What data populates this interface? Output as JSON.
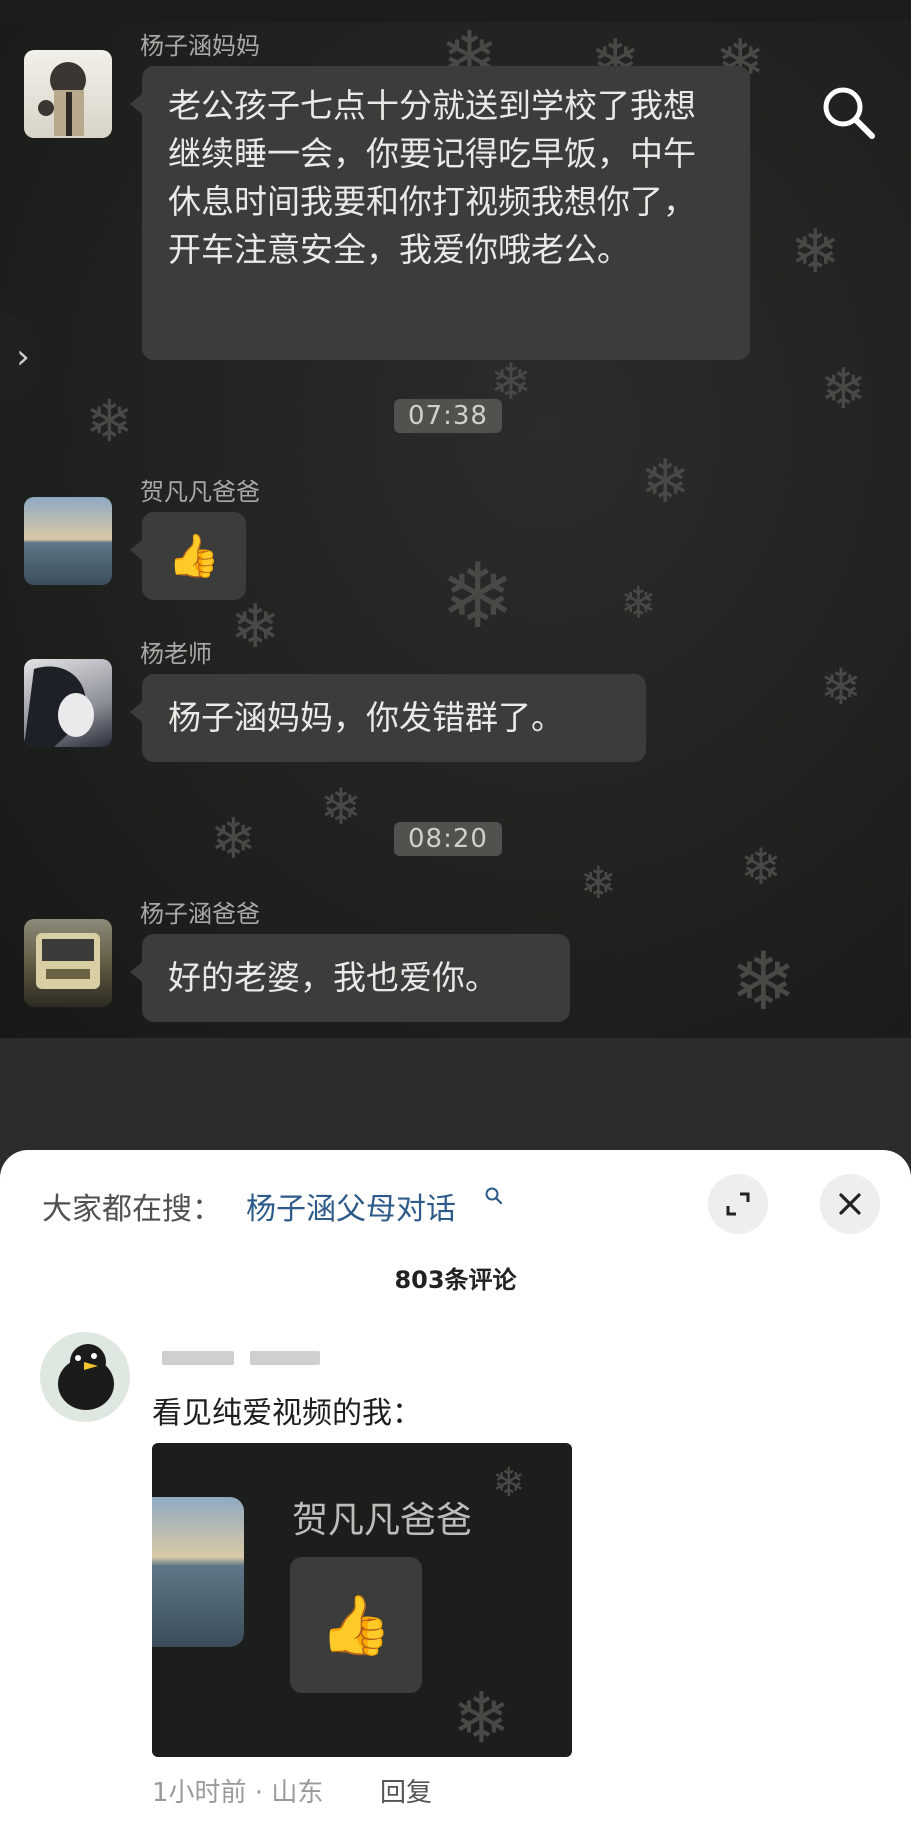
{
  "chat": {
    "messages": [
      {
        "sender": "杨子涵妈妈",
        "text": "老公孩子七点十分就送到学校了我想继续睡一会，你要记得吃早饭，中午休息时间我要和你打视频我想你了，开车注意安全，我爱你哦老公。"
      },
      {
        "time": "07:38"
      },
      {
        "sender": "贺凡凡爸爸",
        "emoji": "👍"
      },
      {
        "sender": "杨老师",
        "text": "杨子涵妈妈，你发错群了。"
      },
      {
        "time": "08:20"
      },
      {
        "sender": "杨子涵爸爸",
        "text": "好的老婆，我也爱你。"
      }
    ]
  },
  "icons": {
    "search": "search-icon",
    "side_arrow": "chevron-right-icon",
    "expand": "expand-icon",
    "close": "close-icon"
  },
  "comments_panel": {
    "search_hint": "大家都在搜：",
    "search_term": "杨子涵父母对话",
    "count_label": "803条评论",
    "comment": {
      "text": "看见纯爱视频的我：",
      "image": {
        "sender": "贺凡凡爸爸",
        "emoji": "👍"
      },
      "meta": "1小时前 · 山东",
      "reply": "回复"
    }
  },
  "colors": {
    "bubble": "#3c3d3a",
    "link": "#2e5b8a",
    "panel_bg": "#ffffff"
  }
}
